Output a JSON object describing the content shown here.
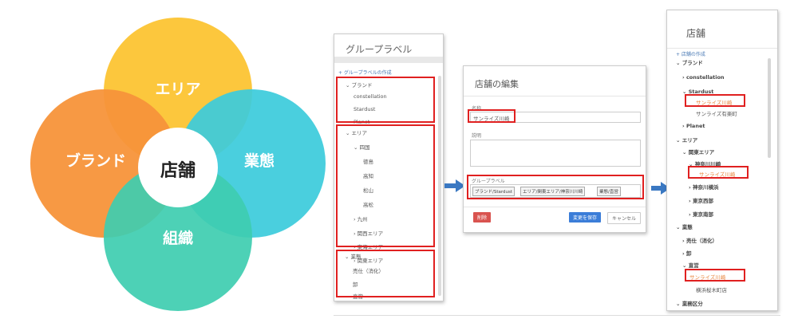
{
  "venn": {
    "center": "店舗",
    "top": "エリア",
    "left": "ブランド",
    "right": "業態",
    "bottom": "組織",
    "colors": {
      "top": "#fcc537",
      "left": "#f7933a",
      "right": "#3ccbdc",
      "bottom": "#3ecdb0"
    }
  },
  "group_panel": {
    "title": "グループラベル",
    "create_link": "+ グループラベルの作成",
    "rows": [
      {
        "text": "⌄ ブランド"
      },
      {
        "text": "constellation"
      },
      {
        "text": "Stardust"
      },
      {
        "text": "Planet"
      },
      {
        "text": "⌄ エリア"
      },
      {
        "text": "⌄ 四国"
      },
      {
        "text": "徳島"
      },
      {
        "text": "高知"
      },
      {
        "text": "松山"
      },
      {
        "text": "高松"
      },
      {
        "text": "› 九州"
      },
      {
        "text": "› 関西エリア"
      },
      {
        "text": "› 東海エリア"
      },
      {
        "text": "› 関東エリア"
      },
      {
        "text": "⌄ 業態"
      },
      {
        "text": "売仕（消化）"
      },
      {
        "text": "卸"
      },
      {
        "text": "直営"
      }
    ]
  },
  "edit_panel": {
    "title": "店舗の編集",
    "name_label": "名称",
    "name_value": "サンライズ川崎",
    "desc_label": "説明",
    "group_label": "グループラベル",
    "tags": [
      "ブランド/Stardust",
      "エリア/関東エリア/神奈川川崎",
      "業態/直営"
    ],
    "delete_label": "削除",
    "save_label": "変更を保存",
    "cancel_label": "キャンセル",
    "colors": {
      "delete": "#d9534f",
      "save": "#3b7dd8"
    }
  },
  "store_panel": {
    "title": "店舗",
    "create_link": "+ 店舗の作成",
    "rows": [
      {
        "text": "⌄ ブランド"
      },
      {
        "text": "› constellation"
      },
      {
        "text": "⌄ Stardust"
      },
      {
        "text": "サンライズ川崎"
      },
      {
        "text": "サンライズ有楽町"
      },
      {
        "text": "› Planet"
      },
      {
        "text": "⌄ エリア"
      },
      {
        "text": "⌄ 関東エリア"
      },
      {
        "text": "⌄ 神奈川川崎"
      },
      {
        "text": "サンライズ川崎"
      },
      {
        "text": "› 神奈川横浜"
      },
      {
        "text": "› 東京西部"
      },
      {
        "text": "› 東京南部"
      },
      {
        "text": "⌄ 業態"
      },
      {
        "text": "› 売仕（消化）"
      },
      {
        "text": "› 卸"
      },
      {
        "text": "⌄ 直営"
      },
      {
        "text": "サンライズ川崎"
      },
      {
        "text": "横浜桜木町店"
      },
      {
        "text": "⌄ 業務区分"
      }
    ]
  },
  "colors": {
    "highlight_box": "#e02020",
    "arrow": "#3a78c2",
    "highlight_text": "#e8833a"
  }
}
